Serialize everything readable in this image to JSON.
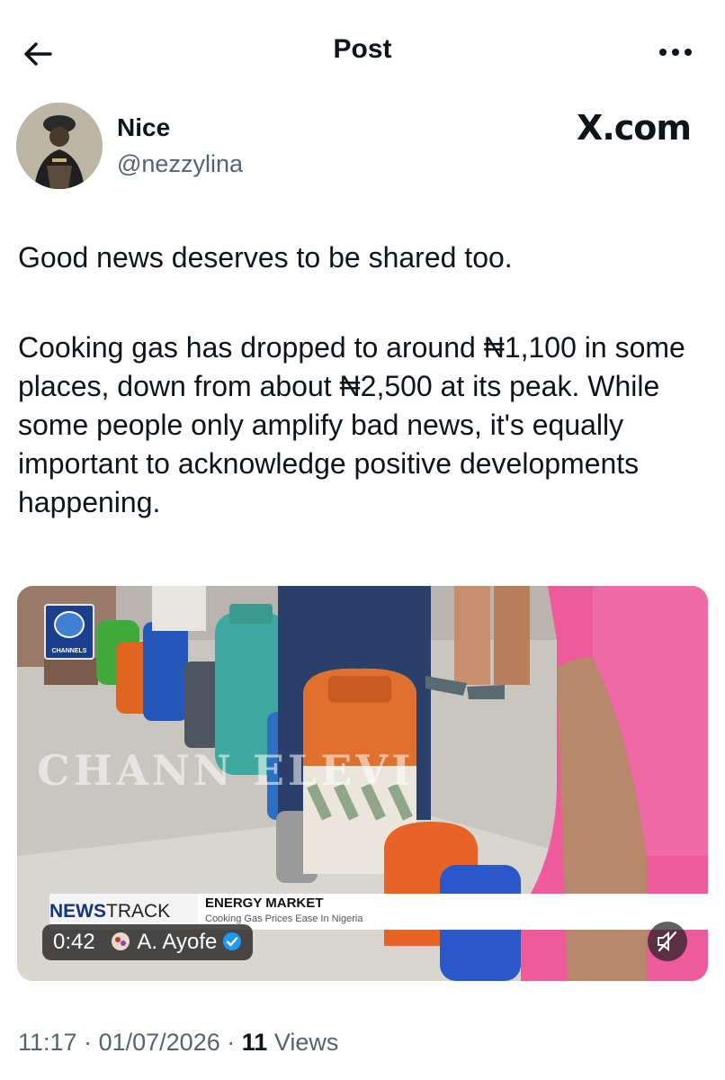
{
  "header": {
    "title": "Post"
  },
  "author": {
    "name": "Nice",
    "handle": "@nezzylina"
  },
  "brand": "X.com",
  "post": {
    "paragraphs": [
      "Good news deserves to be shared too.",
      "Cooking gas has dropped to around ₦1,100 in some places, down from about ₦2,500 at its peak. While some people only amplify bad news, it's equally important to acknowledge positive developments happening."
    ]
  },
  "video": {
    "channel_logo_text": "CHANNELS",
    "watermark": "CHANN        ELEVI",
    "ticker": {
      "brand_bold": "NEWS",
      "brand_light": "TRACK",
      "headline": "ENERGY MARKET",
      "subline": "Cooking Gas Prices Ease In Nigeria"
    },
    "duration": "0:42",
    "uploader": "A. Ayofe"
  },
  "meta": {
    "time": "11:17",
    "date": "01/07/2026",
    "views_count": "11",
    "views_label": "Views",
    "separator": "·"
  },
  "icons": [
    "back-arrow-icon",
    "more-options-icon",
    "avatar-image",
    "verified-badge-icon",
    "mute-icon"
  ],
  "colors": {
    "text": "#0f1419",
    "secondary": "#536471",
    "verified": "#1d9bf0"
  }
}
